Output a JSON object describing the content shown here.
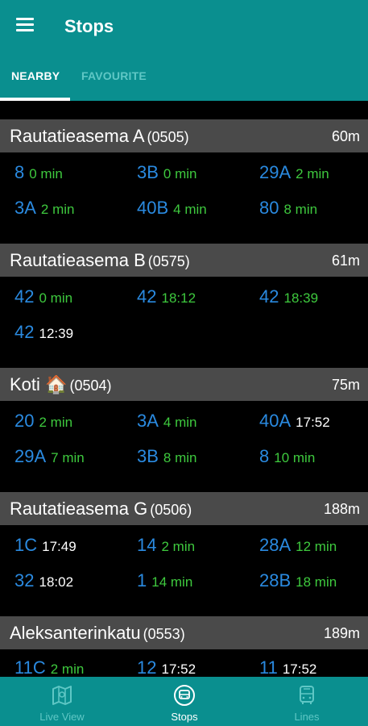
{
  "app": {
    "title": "Stops",
    "colors": {
      "primary": "#0a8f8f",
      "realtime": "#3ec93e",
      "line": "#2a8ae0",
      "scheduled": "#ffffff"
    }
  },
  "tabs": [
    {
      "label": "NEARBY",
      "active": true
    },
    {
      "label": "FAVOURITE",
      "active": false
    }
  ],
  "stops": [
    {
      "name": "Rautatieasema A",
      "code": "(0505)",
      "distance": "60m",
      "departures": [
        {
          "line": "8",
          "time": "0 min",
          "realtime": true
        },
        {
          "line": "3B",
          "time": "0 min",
          "realtime": true
        },
        {
          "line": "29A",
          "time": "2 min",
          "realtime": true
        },
        {
          "line": "3A",
          "time": "2 min",
          "realtime": true
        },
        {
          "line": "40B",
          "time": "4 min",
          "realtime": true
        },
        {
          "line": "80",
          "time": "8 min",
          "realtime": true
        }
      ]
    },
    {
      "name": "Rautatieasema B",
      "code": "(0575)",
      "distance": "61m",
      "departures": [
        {
          "line": "42",
          "time": "0 min",
          "realtime": true
        },
        {
          "line": "42",
          "time": "18:12",
          "realtime": true
        },
        {
          "line": "42",
          "time": "18:39",
          "realtime": true
        },
        {
          "line": "42",
          "time": "12:39",
          "realtime": false
        }
      ]
    },
    {
      "name": "Koti",
      "emoji": "🏠",
      "code": "(0504)",
      "distance": "75m",
      "departures": [
        {
          "line": "20",
          "time": "2 min",
          "realtime": true
        },
        {
          "line": "3A",
          "time": "4 min",
          "realtime": true
        },
        {
          "line": "40A",
          "time": "17:52",
          "realtime": false
        },
        {
          "line": "29A",
          "time": "7 min",
          "realtime": true
        },
        {
          "line": "3B",
          "time": "8 min",
          "realtime": true
        },
        {
          "line": "8",
          "time": "10 min",
          "realtime": true
        }
      ]
    },
    {
      "name": "Rautatieasema G",
      "code": "(0506)",
      "distance": "188m",
      "departures": [
        {
          "line": "1C",
          "time": "17:49",
          "realtime": false
        },
        {
          "line": "14",
          "time": "2 min",
          "realtime": true
        },
        {
          "line": "28A",
          "time": "12 min",
          "realtime": true
        },
        {
          "line": "32",
          "time": "18:02",
          "realtime": false
        },
        {
          "line": "1",
          "time": "14 min",
          "realtime": true
        },
        {
          "line": "28B",
          "time": "18 min",
          "realtime": true
        }
      ]
    },
    {
      "name": "Aleksanterinkatu",
      "code": "(0553)",
      "distance": "189m",
      "departures": [
        {
          "line": "11C",
          "time": "2 min",
          "realtime": true
        },
        {
          "line": "12",
          "time": "17:52",
          "realtime": false
        },
        {
          "line": "11",
          "time": "17:52",
          "realtime": false
        }
      ]
    }
  ],
  "bottom_nav": [
    {
      "label": "Live View",
      "icon": "map-icon",
      "active": false
    },
    {
      "label": "Stops",
      "icon": "bus-front-icon",
      "active": true
    },
    {
      "label": "Lines",
      "icon": "bus-icon",
      "active": false
    }
  ]
}
